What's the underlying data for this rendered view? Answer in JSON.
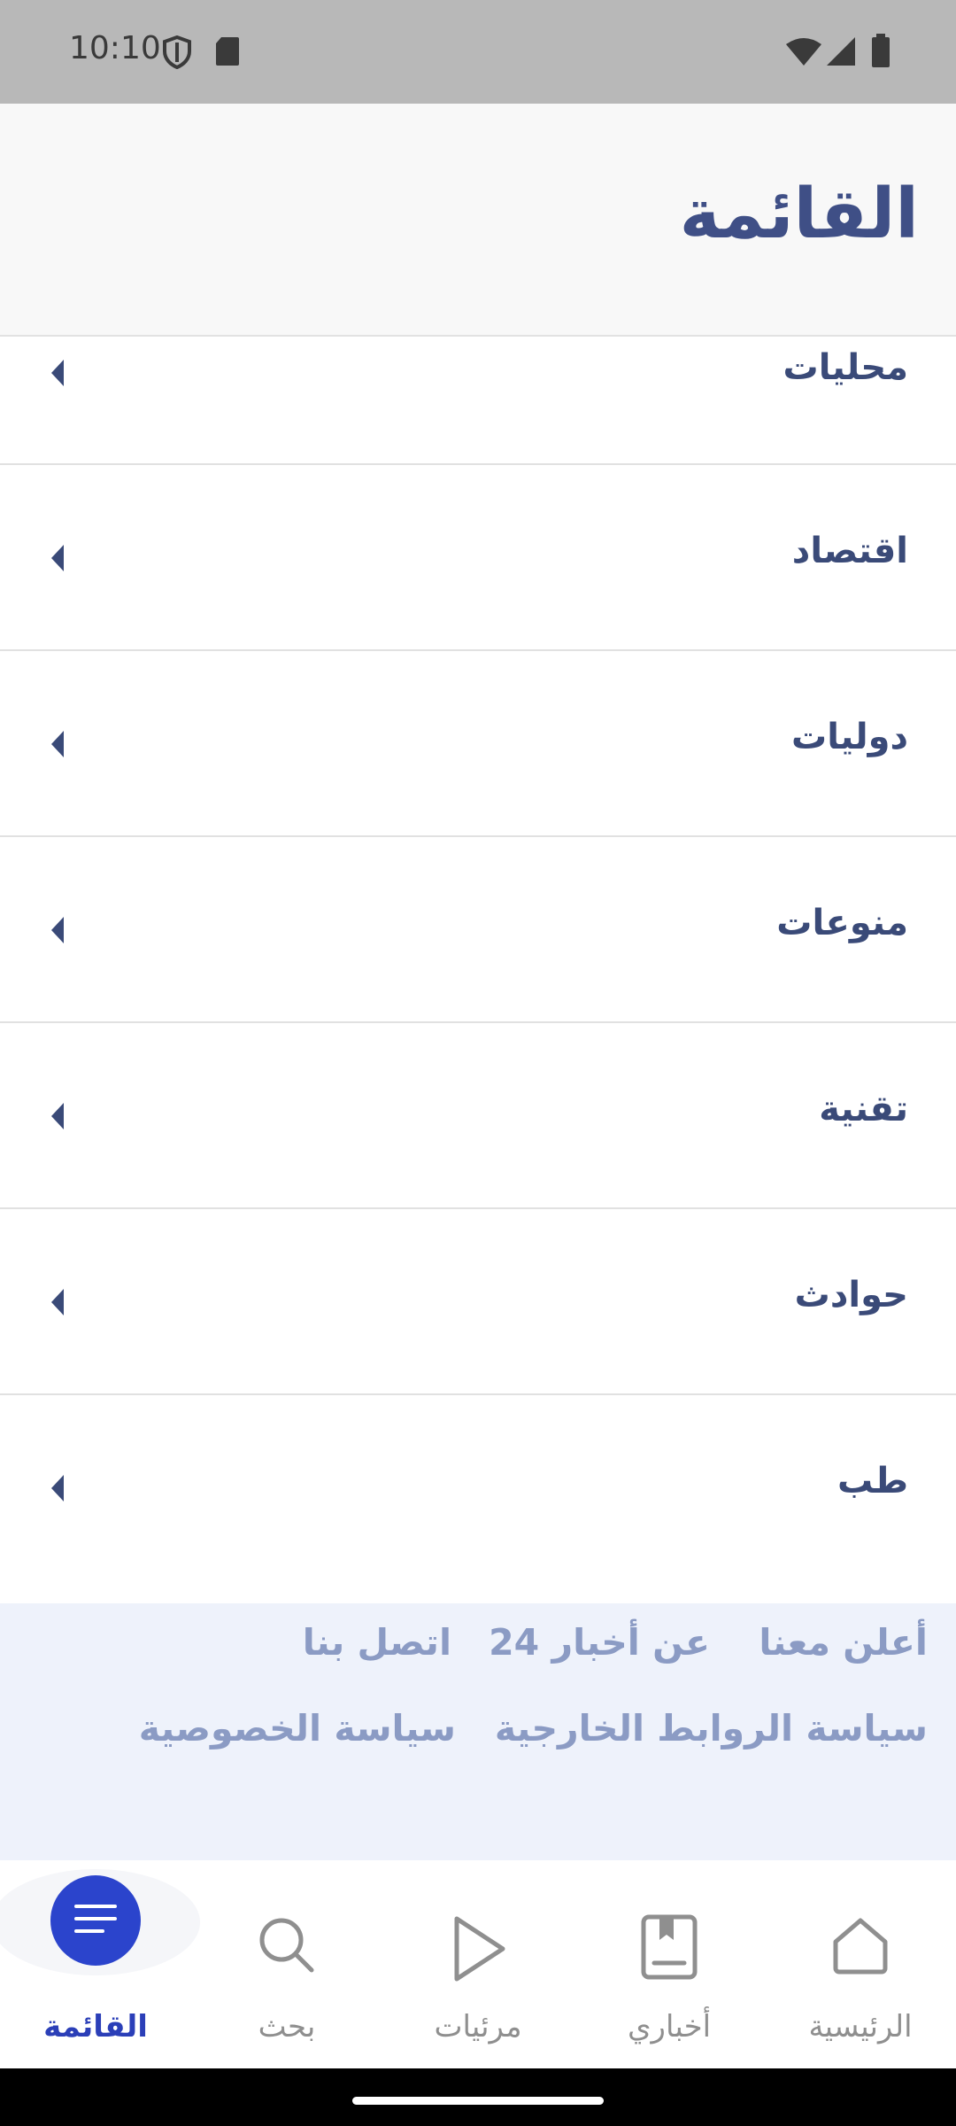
{
  "status_bar": {
    "time": "10:10"
  },
  "header": {
    "title": "القائمة"
  },
  "menu": {
    "items": [
      {
        "label": "محليات"
      },
      {
        "label": "اقتصاد"
      },
      {
        "label": "دوليات"
      },
      {
        "label": "منوعات"
      },
      {
        "label": "تقنية"
      },
      {
        "label": "حوادث"
      },
      {
        "label": "طب"
      }
    ]
  },
  "footer": {
    "advertise": "أعلن معنا",
    "about": "عن أخبار 24",
    "contact": "اتصل بنا",
    "external_links_policy": "سياسة الروابط الخارجية",
    "privacy_policy": "سياسة الخصوصية"
  },
  "bottom_nav": {
    "home": "الرئيسية",
    "my_news": "أخباري",
    "videos": "مرئيات",
    "search": "بحث",
    "menu": "القائمة"
  },
  "colors": {
    "accent": "#2b44cc",
    "title": "#3f4f86",
    "footer_link": "#8b9bc4"
  }
}
